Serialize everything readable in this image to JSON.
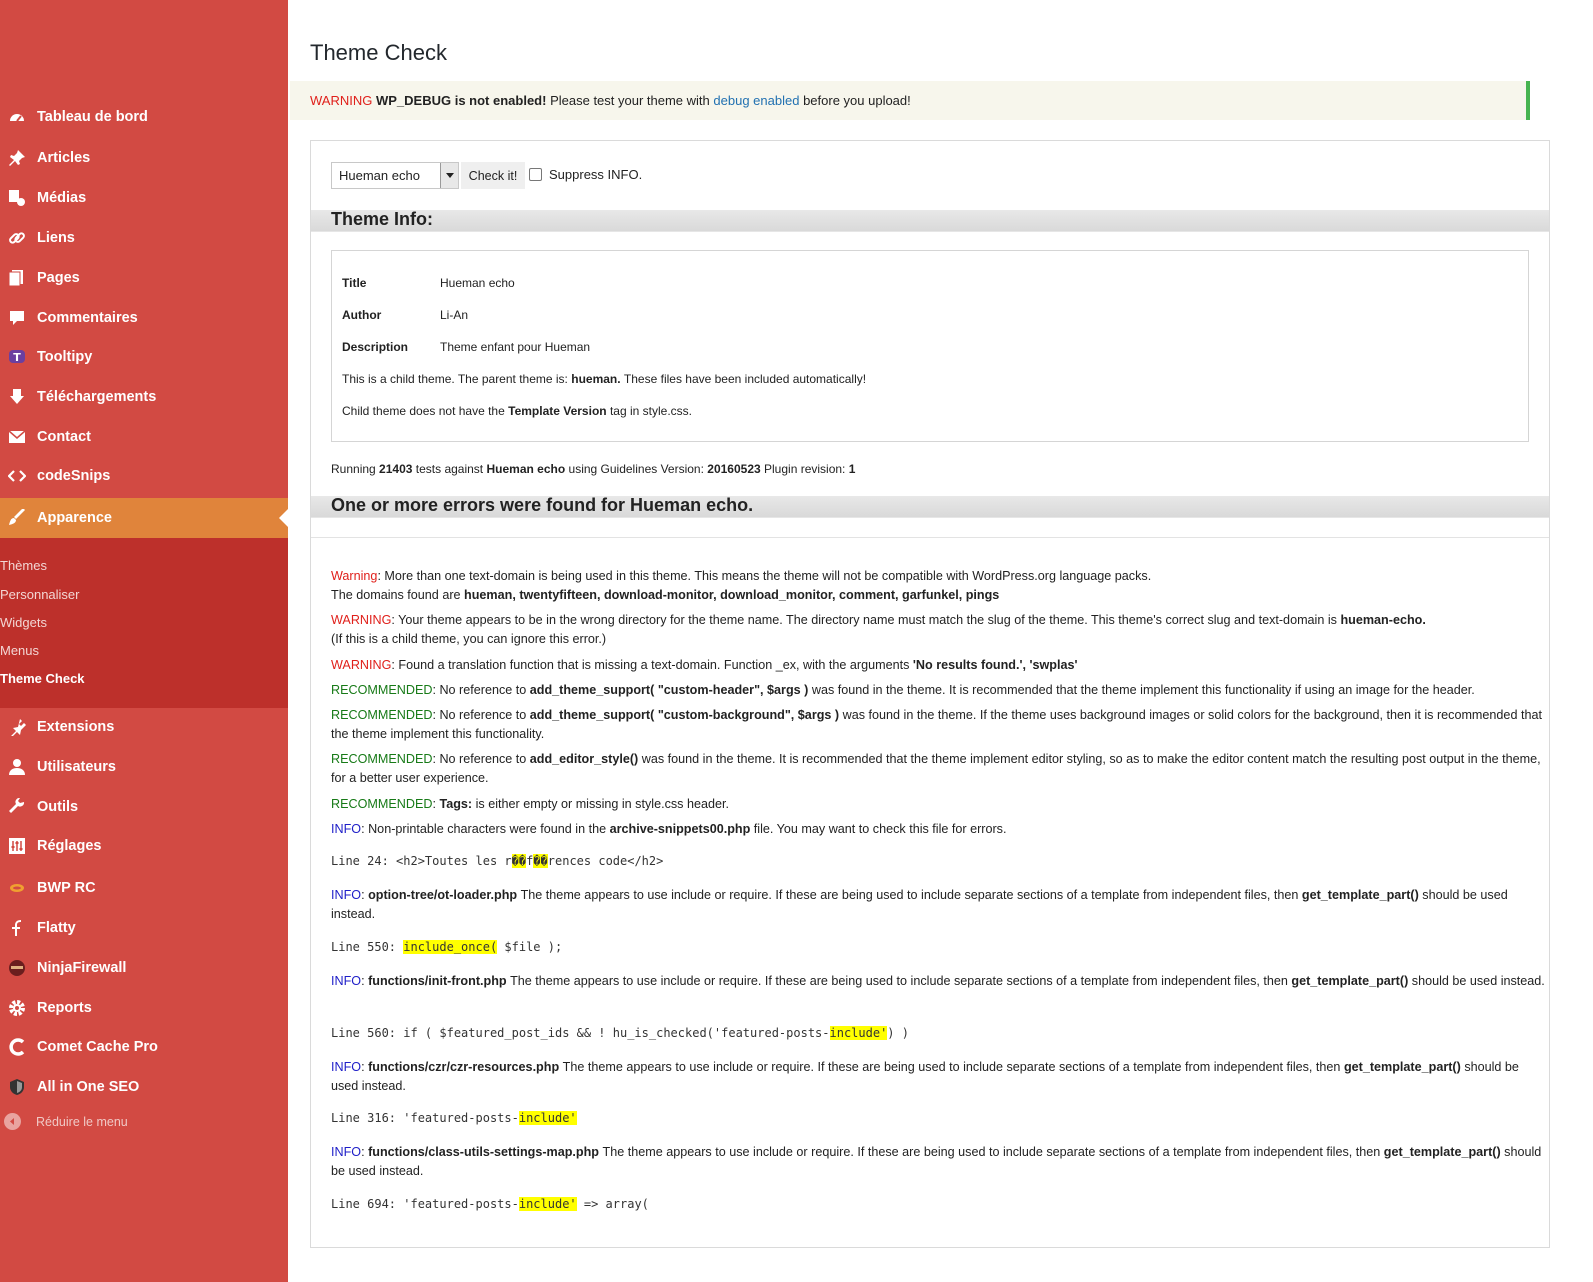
{
  "colors": {
    "sidebar": "#d24a43",
    "sidebar_active": "#e0843b",
    "submenu": "#bd302b",
    "notice_border": "#46b450",
    "warning": "#e0201b",
    "info": "#1e1ec8",
    "recommended": "#177a17",
    "highlight": "#ffff00"
  },
  "sidebar": {
    "items": [
      {
        "label": "Tableau de bord",
        "icon": "dashboard-icon"
      },
      {
        "label": "Articles",
        "icon": "pin-icon"
      },
      {
        "label": "Médias",
        "icon": "media-icon"
      },
      {
        "label": "Liens",
        "icon": "link-icon"
      },
      {
        "label": "Pages",
        "icon": "pages-icon"
      },
      {
        "label": "Commentaires",
        "icon": "comment-icon"
      },
      {
        "label": "Tooltipy",
        "icon": "tooltipy-icon"
      },
      {
        "label": "Téléchargements",
        "icon": "download-icon"
      },
      {
        "label": "Contact",
        "icon": "mail-icon"
      },
      {
        "label": "codeSnips",
        "icon": "code-icon"
      },
      {
        "label": "Apparence",
        "icon": "brush-icon"
      },
      {
        "label": "Extensions",
        "icon": "plugin-icon"
      },
      {
        "label": "Utilisateurs",
        "icon": "user-icon"
      },
      {
        "label": "Outils",
        "icon": "wrench-icon"
      },
      {
        "label": "Réglages",
        "icon": "settings-icon"
      },
      {
        "label": "BWP RC",
        "icon": "bwp-icon"
      },
      {
        "label": "Flatty",
        "icon": "flatty-icon"
      },
      {
        "label": "NinjaFirewall",
        "icon": "ninja-icon"
      },
      {
        "label": "Reports",
        "icon": "gear-icon"
      },
      {
        "label": "Comet Cache Pro",
        "icon": "comet-icon"
      },
      {
        "label": "All in One SEO",
        "icon": "shield-icon"
      }
    ],
    "submenu": [
      "Thèmes",
      "Personnaliser",
      "Widgets",
      "Menus",
      "Theme Check"
    ],
    "collapse": "Réduire le menu"
  },
  "page": {
    "title": "Theme Check"
  },
  "notice": {
    "warning": "WARNING",
    "wpdebug": "WP_DEBUG is not enabled!",
    "text1": "Please test your theme with",
    "link": "debug enabled",
    "text2": "before you upload!"
  },
  "form": {
    "selected_theme": "Hueman echo",
    "check_button": "Check it!",
    "suppress_label": "Suppress INFO."
  },
  "theme_info": {
    "heading": "Theme Info:",
    "rows": [
      {
        "key": "Title",
        "value": "Hueman echo"
      },
      {
        "key": "Author",
        "value": "Li-An"
      },
      {
        "key": "Description",
        "value": "Theme enfant pour Hueman"
      }
    ],
    "child_a": "This is a child theme. The parent theme is:",
    "child_b": "hueman.",
    "child_c": "These files have been included automatically!",
    "tpl_a": "Child theme does not have the",
    "tpl_b": "Template Version",
    "tpl_c": "tag in style.css."
  },
  "running": {
    "a": "Running",
    "tests": "21403",
    "b": "tests against",
    "theme": "Hueman echo",
    "c": "using Guidelines Version:",
    "version": "20160523",
    "d": "Plugin revision:",
    "revision": "1"
  },
  "results": {
    "heading": "One or more errors were found for Hueman echo.",
    "m1": {
      "tag": "Warning",
      "text": ": More than one text-domain is being used in this theme. This means the theme will not be compatible with WordPress.org language packs.",
      "l2": "The domains found are",
      "domains": "hueman, twentyfifteen, download-monitor, download_monitor, comment, garfunkel, pings"
    },
    "m2": {
      "tag": "WARNING",
      "text": ": Your theme appears to be in the wrong directory for the theme name. The directory name must match the slug of the theme. This theme's correct slug and text-domain is",
      "slug": "hueman-echo.",
      "l2": "(If this is a child theme, you can ignore this error.)"
    },
    "m3": {
      "tag": "WARNING",
      "text": ": Found a translation function that is missing a text-domain. Function _ex, with the arguments",
      "args": "'No results found.', 'swplas'"
    },
    "m4": {
      "tag": "RECOMMENDED",
      "a": ": No reference to",
      "code": "add_theme_support( \"custom-header\", $args )",
      "b": "was found in the theme. It is recommended that the theme implement this functionality if using an image for the header."
    },
    "m5": {
      "tag": "RECOMMENDED",
      "a": ": No reference to",
      "code": "add_theme_support( \"custom-background\", $args )",
      "b": "was found in the theme. If the theme uses background images or solid colors for the background, then it is recommended that the theme implement this functionality."
    },
    "m6": {
      "tag": "RECOMMENDED",
      "a": ": No reference to",
      "code": "add_editor_style()",
      "b": "was found in the theme. It is recommended that the theme implement editor styling, so as to make the editor content match the resulting post output in the theme, for a better user experience."
    },
    "m7": {
      "tag": "RECOMMENDED",
      "a": ":",
      "code": "Tags:",
      "b": "is either empty or missing in style.css header."
    },
    "m8": {
      "tag": "INFO",
      "a": ": Non-printable characters were found in the",
      "file": "archive-snippets00.php",
      "b": "file. You may want to check this file for errors."
    },
    "c1": {
      "a": "Line 24: <h2>Toutes les r",
      "h1": "��",
      "b": "f",
      "h2": "��",
      "c": "rences code</h2>"
    },
    "i1": {
      "tag": "INFO",
      "file": "option-tree/ot-loader.php",
      "a": "The theme appears to use include or require. If these are being used to include separate sections of a template from independent files, then",
      "fn": "get_template_part()",
      "b": "should be used instead."
    },
    "c2": {
      "a": "Line 550: ",
      "h": "include_once(",
      "b": " $file );"
    },
    "i2": {
      "tag": "INFO",
      "file": "functions/init-front.php",
      "a": "The theme appears to use include or require. If these are being used to include separate sections of a template from independent files, then",
      "fn": "get_template_part()",
      "b": "should be used instead."
    },
    "c3": {
      "a": "Line 560: if ( $featured_post_ids && ! hu_is_checked('featured-posts-",
      "h": "include'",
      "b": ") )"
    },
    "i3": {
      "tag": "INFO",
      "file": "functions/czr/czr-resources.php",
      "a": "The theme appears to use include or require. If these are being used to include separate sections of a template from independent files, then",
      "fn": "get_template_part()",
      "b": "should be used instead."
    },
    "c4": {
      "a": "Line 316: 'featured-posts-",
      "h": "include'",
      "b": ""
    },
    "i4": {
      "tag": "INFO",
      "file": "functions/class-utils-settings-map.php",
      "a": "The theme appears to use include or require. If these are being used to include separate sections of a template from independent files, then",
      "fn": "get_template_part()",
      "b": "should be used instead."
    },
    "c5": {
      "a": "Line 694: 'featured-posts-",
      "h": "include'",
      "b": " => array("
    }
  }
}
